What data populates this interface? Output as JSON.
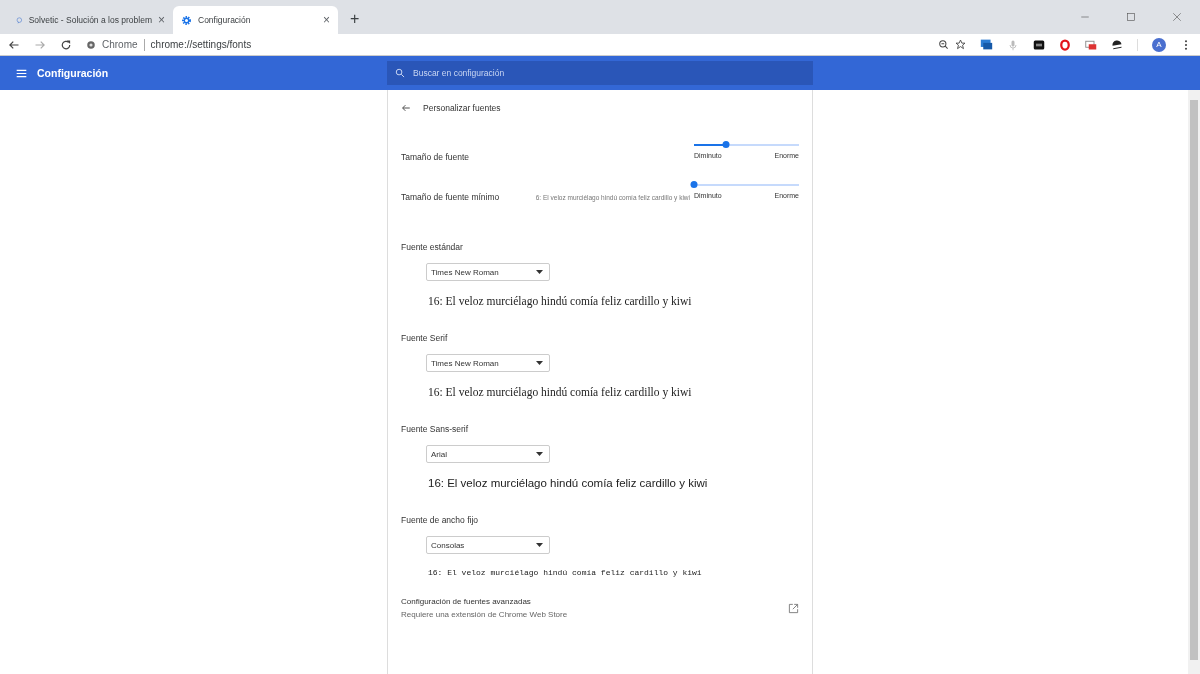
{
  "browser": {
    "tabs": [
      {
        "title": "Solvetic - Solución a los problem",
        "selected": false,
        "close": "×"
      },
      {
        "title": "Configuración",
        "selected": true,
        "close": "×"
      }
    ],
    "new_tab": "+",
    "address": {
      "site_label": "Chrome",
      "url": "chrome://settings/fonts"
    },
    "profile_initial": "A"
  },
  "header": {
    "title": "Configuración",
    "search": {
      "placeholder": "Buscar en configuración"
    }
  },
  "page": {
    "title": "Personalizar fuentes",
    "size_settings": [
      {
        "label": "Tamaño de fuente",
        "level": 0.3,
        "min_label": "Diminuto",
        "max_label": "Enorme"
      },
      {
        "label": "Tamaño de fuente mínimo",
        "preview": "6: El veloz murciélago hindú comía feliz cardillo y kiwi",
        "level": 0,
        "min_label": "Diminuto",
        "max_label": "Enorme"
      }
    ],
    "font_families": [
      {
        "label": "Fuente estándar",
        "kind": "serif",
        "font": "Times New Roman",
        "sample": "16: El veloz murciélago hindú comía feliz cardillo y kiwi"
      },
      {
        "label": "Fuente Serif",
        "kind": "serif",
        "font": "Times New Roman",
        "sample": "16: El veloz murciélago hindú comía feliz cardillo y kiwi"
      },
      {
        "label": "Fuente Sans-serif",
        "kind": "sans",
        "font": "Arial",
        "sample": "16: El veloz murciélago hindú comía feliz cardillo y kiwi"
      },
      {
        "label": "Fuente de ancho fijo",
        "kind": "mono",
        "font": "Consolas",
        "sample": "16: El veloz murciélago hindú comía feliz cardillo y kiwi"
      }
    ],
    "advanced": {
      "title": "Configuración de fuentes avanzadas",
      "subtitle": "Requiere una extensión de Chrome Web Store"
    }
  }
}
